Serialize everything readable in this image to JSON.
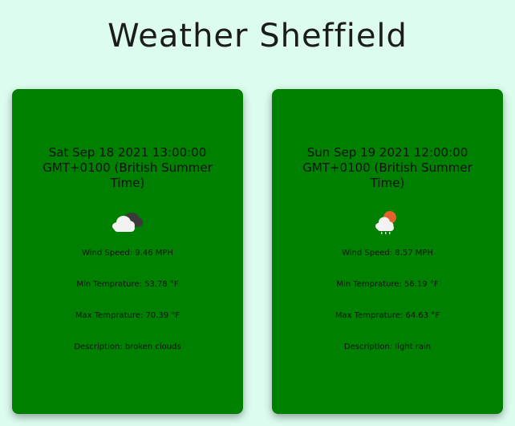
{
  "header": {
    "title": "Weather Sheffield"
  },
  "forecasts": [
    {
      "date": "Sat Sep 18 2021 13:00:00 GMT+0100 (British Summer Time)",
      "icon": "broken-clouds-icon",
      "wind_speed": "Wind Speed: 9.46 MPH",
      "min_temp": "Min Temprature: 53.78 °F",
      "max_temp": "Max Temprature: 70.39 °F",
      "description": "Description: broken clouds"
    },
    {
      "date": "Sun Sep 19 2021 12:00:00 GMT+0100 (British Summer Time)",
      "icon": "light-rain-icon",
      "wind_speed": "Wind Speed: 8.57 MPH",
      "min_temp": "Min Temprature: 56.19 °F",
      "max_temp": "Max Temprature: 64.63 °F",
      "description": "Description: light rain"
    }
  ],
  "colors": {
    "background": "#dcfcee",
    "card": "#008000",
    "text": "#1c1c1c"
  }
}
